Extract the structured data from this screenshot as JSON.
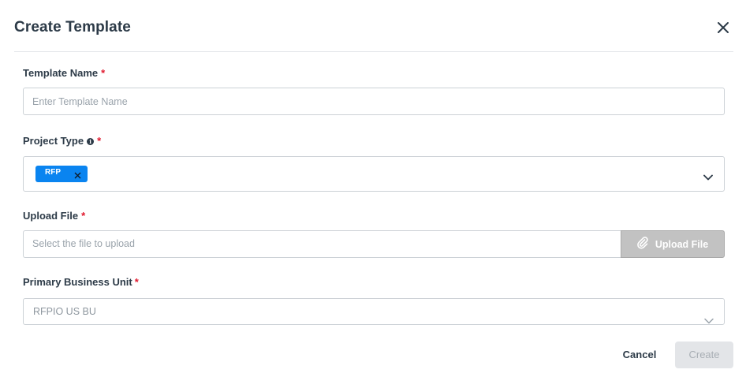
{
  "dialog": {
    "title": "Create Template"
  },
  "fields": {
    "template_name": {
      "label": "Template Name",
      "required_marker": "*",
      "placeholder": "Enter Template Name",
      "value": ""
    },
    "project_type": {
      "label": "Project Type",
      "info_icon": "info-icon",
      "required_marker": "*",
      "selected_chips": [
        "RFP"
      ]
    },
    "upload_file": {
      "label": "Upload File",
      "required_marker": "*",
      "placeholder": "Select the file to upload",
      "button_label": "Upload File",
      "button_icon": "paperclip-icon"
    },
    "primary_business_unit": {
      "label": "Primary Business Unit",
      "required_marker": "*",
      "selected_value": "RFPIO US BU"
    }
  },
  "footer": {
    "cancel_label": "Cancel",
    "create_label": "Create"
  },
  "colors": {
    "chip_bg": "#0a84f0",
    "required": "#e0182d",
    "upload_btn_bg": "#c2c2c2",
    "create_btn_bg": "#e3e5e8"
  }
}
